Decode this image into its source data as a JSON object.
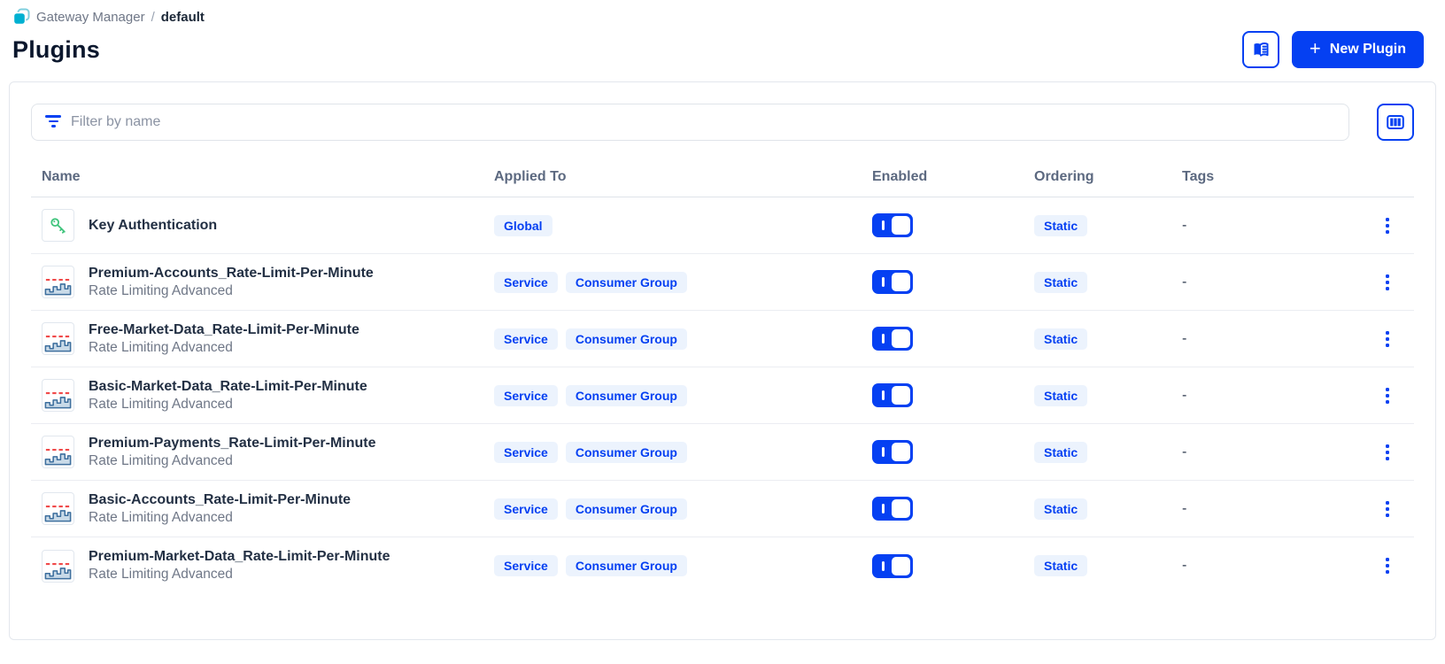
{
  "breadcrumb": {
    "app": "Gateway Manager",
    "separator": "/",
    "current": "default"
  },
  "header": {
    "title": "Plugins",
    "new_plugin_label": "New Plugin",
    "plus_glyph": "+"
  },
  "toolbar": {
    "filter_placeholder": "Filter by name"
  },
  "icons": {
    "breadcrumb": "stacked-squares-icon",
    "docs": "open-book-icon",
    "filter": "funnel-lines-icon",
    "columns": "table-columns-icon",
    "row_key": "key-icon",
    "row_rate_limit": "rate-limit-step-chart-icon",
    "row_menu": "kebab-menu-icon"
  },
  "colors": {
    "accent_blue": "#0540f2",
    "badge_background": "#ecf3fd",
    "breadcrumb_teal": "#00b0d1",
    "key_green": "#3fc47c",
    "rate_limit_red": "#f04a4a",
    "rate_limit_steel": "#3d6f9e",
    "title_navy": "#0b172d"
  },
  "table": {
    "columns": [
      "Name",
      "Applied To",
      "Enabled",
      "Ordering",
      "Tags"
    ],
    "toggle_on_glyph": "I",
    "rows": [
      {
        "name": "Key Authentication",
        "subtitle": "",
        "icon": "key-icon",
        "applied_to": [
          "Global"
        ],
        "enabled": true,
        "ordering": "Static",
        "tags": "-"
      },
      {
        "name": "Premium-Accounts_Rate-Limit-Per-Minute",
        "subtitle": "Rate Limiting Advanced",
        "icon": "rate-limit-icon",
        "applied_to": [
          "Service",
          "Consumer Group"
        ],
        "enabled": true,
        "ordering": "Static",
        "tags": "-"
      },
      {
        "name": "Free-Market-Data_Rate-Limit-Per-Minute",
        "subtitle": "Rate Limiting Advanced",
        "icon": "rate-limit-icon",
        "applied_to": [
          "Service",
          "Consumer Group"
        ],
        "enabled": true,
        "ordering": "Static",
        "tags": "-"
      },
      {
        "name": "Basic-Market-Data_Rate-Limit-Per-Minute",
        "subtitle": "Rate Limiting Advanced",
        "icon": "rate-limit-icon",
        "applied_to": [
          "Service",
          "Consumer Group"
        ],
        "enabled": true,
        "ordering": "Static",
        "tags": "-"
      },
      {
        "name": "Premium-Payments_Rate-Limit-Per-Minute",
        "subtitle": "Rate Limiting Advanced",
        "icon": "rate-limit-icon",
        "applied_to": [
          "Service",
          "Consumer Group"
        ],
        "enabled": true,
        "ordering": "Static",
        "tags": "-"
      },
      {
        "name": "Basic-Accounts_Rate-Limit-Per-Minute",
        "subtitle": "Rate Limiting Advanced",
        "icon": "rate-limit-icon",
        "applied_to": [
          "Service",
          "Consumer Group"
        ],
        "enabled": true,
        "ordering": "Static",
        "tags": "-"
      },
      {
        "name": "Premium-Market-Data_Rate-Limit-Per-Minute",
        "subtitle": "Rate Limiting Advanced",
        "icon": "rate-limit-icon",
        "applied_to": [
          "Service",
          "Consumer Group"
        ],
        "enabled": true,
        "ordering": "Static",
        "tags": "-"
      }
    ]
  }
}
